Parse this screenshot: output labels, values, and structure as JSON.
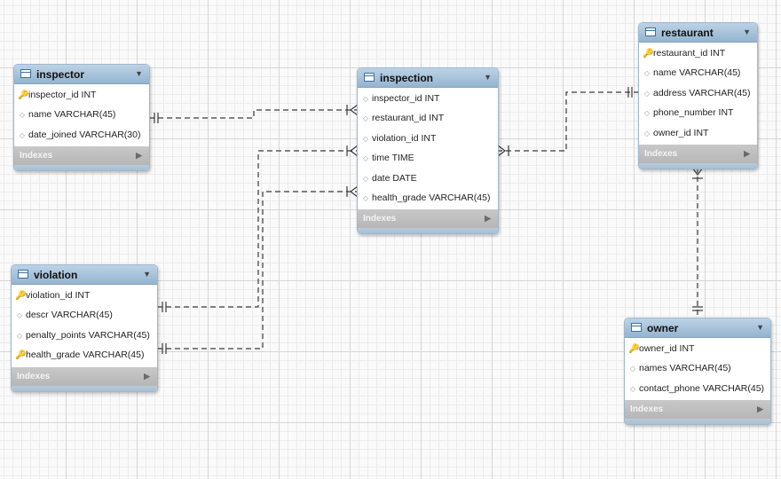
{
  "indexes_label": "Indexes",
  "colors": {
    "header": "#a9c4dc",
    "indexes_bar": "#c0c0c0",
    "primary_key": "#e0b020",
    "connector": "#3a3a3a"
  },
  "tables": {
    "inspector": {
      "name": "inspector",
      "columns": [
        {
          "text": "inspector_id INT",
          "key": "primary"
        },
        {
          "text": "name VARCHAR(45)",
          "key": "none"
        },
        {
          "text": "date_joined VARCHAR(30)",
          "key": "none"
        }
      ]
    },
    "inspection": {
      "name": "inspection",
      "columns": [
        {
          "text": "inspector_id INT",
          "key": "none"
        },
        {
          "text": "restaurant_id INT",
          "key": "none"
        },
        {
          "text": "violation_id INT",
          "key": "none"
        },
        {
          "text": "time TIME",
          "key": "none"
        },
        {
          "text": "date DATE",
          "key": "none"
        },
        {
          "text": "health_grade VARCHAR(45)",
          "key": "none"
        }
      ]
    },
    "restaurant": {
      "name": "restaurant",
      "columns": [
        {
          "text": "restaurant_id INT",
          "key": "primary"
        },
        {
          "text": "name VARCHAR(45)",
          "key": "none"
        },
        {
          "text": "address VARCHAR(45)",
          "key": "none"
        },
        {
          "text": "phone_number INT",
          "key": "none"
        },
        {
          "text": "owner_id INT",
          "key": "none"
        }
      ]
    },
    "violation": {
      "name": "violation",
      "columns": [
        {
          "text": "violation_id INT",
          "key": "primary"
        },
        {
          "text": "descr VARCHAR(45)",
          "key": "none"
        },
        {
          "text": "penalty_points VARCHAR(45)",
          "key": "none"
        },
        {
          "text": "health_grade VARCHAR(45)",
          "key": "primary"
        }
      ]
    },
    "owner": {
      "name": "owner",
      "columns": [
        {
          "text": "owner_id INT",
          "key": "primary"
        },
        {
          "text": "names VARCHAR(45)",
          "key": "none"
        },
        {
          "text": "contact_phone VARCHAR(45)",
          "key": "none"
        }
      ]
    }
  },
  "relationships": [
    {
      "from": "inspector",
      "to": "inspection",
      "from_end": "one",
      "to_end": "many"
    },
    {
      "from": "violation",
      "to": "inspection",
      "from_end": "one",
      "to_end": "many"
    },
    {
      "from": "violation",
      "to": "inspection",
      "from_end": "one",
      "to_end": "many"
    },
    {
      "from": "restaurant",
      "to": "inspection",
      "from_end": "one",
      "to_end": "many"
    },
    {
      "from": "owner",
      "to": "restaurant",
      "from_end": "one",
      "to_end": "many"
    }
  ]
}
